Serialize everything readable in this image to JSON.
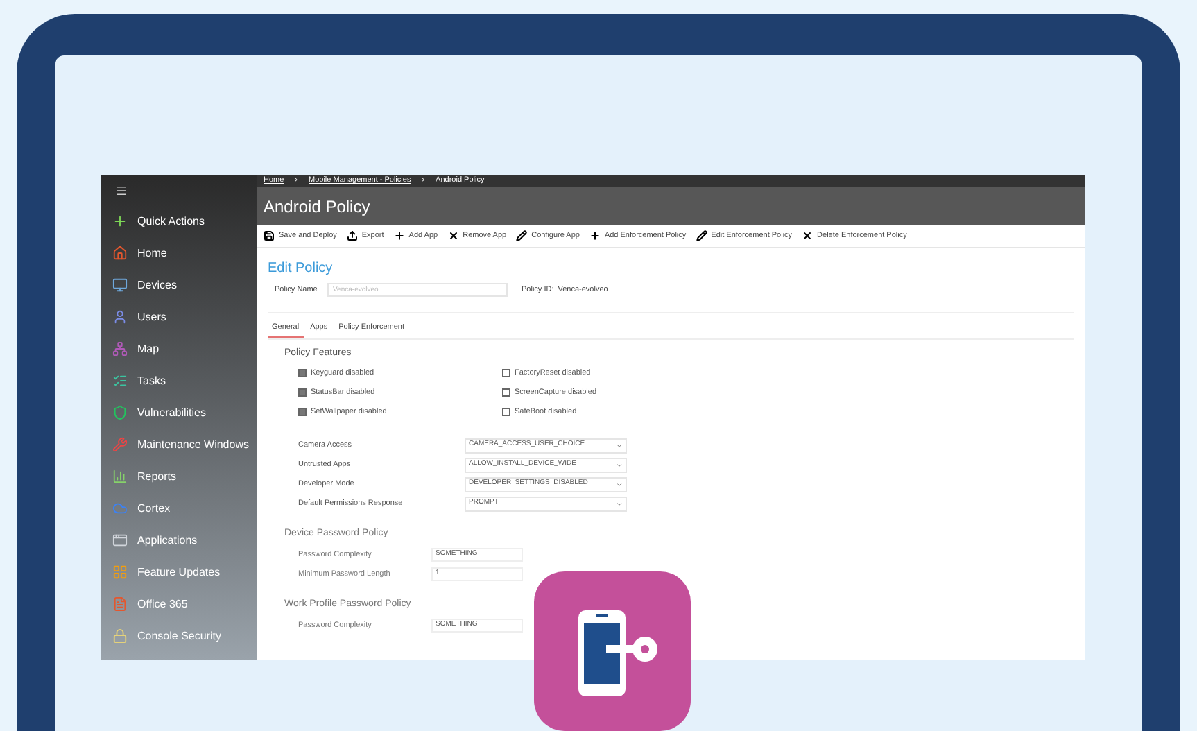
{
  "sidebar": {
    "items": [
      {
        "label": "Quick Actions",
        "kind": "plus"
      },
      {
        "label": "Home",
        "kind": "home"
      },
      {
        "label": "Devices",
        "kind": "monitor"
      },
      {
        "label": "Users",
        "kind": "user"
      },
      {
        "label": "Map",
        "kind": "network"
      },
      {
        "label": "Tasks",
        "kind": "tasks"
      },
      {
        "label": "Vulnerabilities",
        "kind": "shield"
      },
      {
        "label": "Maintenance Windows",
        "kind": "tools"
      },
      {
        "label": "Reports",
        "kind": "chart"
      },
      {
        "label": "Cortex",
        "kind": "cloud"
      },
      {
        "label": "Applications",
        "kind": "window"
      },
      {
        "label": "Feature Updates",
        "kind": "grid"
      },
      {
        "label": "Office 365",
        "kind": "office"
      },
      {
        "label": "Console Security",
        "kind": "lock"
      }
    ]
  },
  "breadcrumb": [
    {
      "label": "Home",
      "kind": "link"
    },
    {
      "label": "›",
      "kind": "separator"
    },
    {
      "label": "Mobile Management - Policies",
      "kind": "link"
    },
    {
      "label": "›",
      "kind": "separator"
    },
    {
      "label": "Android Policy",
      "kind": "current"
    }
  ],
  "page_title": "Android Policy",
  "toolbar": [
    {
      "label": "Save and Deploy",
      "kind": "save"
    },
    {
      "label": "Export",
      "kind": "export"
    },
    {
      "label": "Add App",
      "kind": "add"
    },
    {
      "label": "Remove App",
      "kind": "remove"
    },
    {
      "label": "Configure App",
      "kind": "edit"
    },
    {
      "label": "Add Enforcement Policy",
      "kind": "add"
    },
    {
      "label": "Edit Enforcement Policy",
      "kind": "edit"
    },
    {
      "label": "Delete Enforcement Policy",
      "kind": "remove"
    }
  ],
  "form": {
    "title": "Edit Policy",
    "policy_name": {
      "label": "Policy Name",
      "placeholder": "Venca-evolveo"
    },
    "policy_id": {
      "label": "Policy ID:",
      "value": "Venca-evolveo"
    }
  },
  "tabs": [
    {
      "label": "General",
      "selected": true
    },
    {
      "label": "Apps",
      "selected": false
    },
    {
      "label": "Policy Enforcement",
      "selected": false
    }
  ],
  "features": {
    "heading": "Policy Features",
    "items": [
      {
        "label": "Keyguard disabled",
        "checked": true
      },
      {
        "label": "FactoryReset disabled",
        "checked": false
      },
      {
        "label": "StatusBar disabled",
        "checked": true
      },
      {
        "label": "ScreenCapture disabled",
        "checked": false
      },
      {
        "label": "SetWallpaper disabled",
        "checked": true
      },
      {
        "label": "SafeBoot disabled",
        "checked": false
      }
    ]
  },
  "selects": [
    {
      "label": "Camera Access",
      "value": "CAMERA_ACCESS_USER_CHOICE"
    },
    {
      "label": "Untrusted Apps",
      "value": "ALLOW_INSTALL_DEVICE_WIDE"
    },
    {
      "label": "Developer Mode",
      "value": "DEVELOPER_SETTINGS_DISABLED"
    },
    {
      "label": "Default Permissions Response",
      "value": "PROMPT"
    }
  ],
  "device_password": {
    "heading": "Device Password Policy",
    "rows": [
      {
        "label": "Password Complexity",
        "value": "SOMETHING"
      },
      {
        "label": "Minimum Password Length",
        "value": "1"
      }
    ]
  },
  "work_profile_password": {
    "heading": "Work Profile Password Policy",
    "rows": [
      {
        "label": "Password Complexity",
        "value": "SOMETHING"
      }
    ]
  }
}
